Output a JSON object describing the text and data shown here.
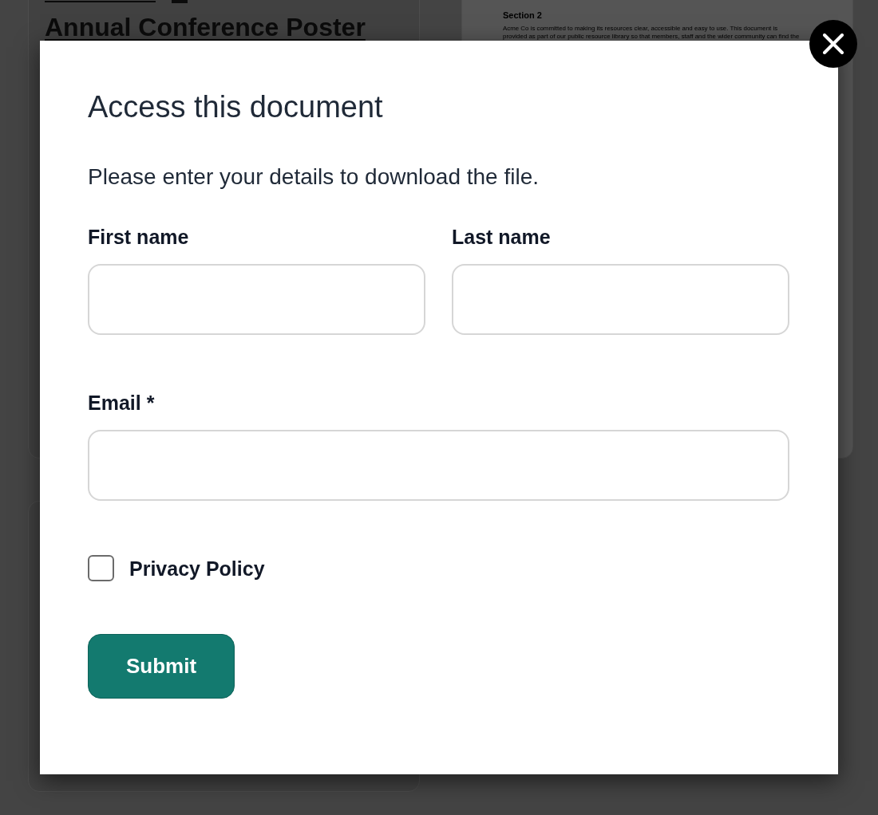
{
  "background": {
    "cards": [
      {
        "kind": "link",
        "title": "Annual Conference Poster"
      },
      {
        "kind": "document",
        "heading": "Section 2",
        "text": "Acme Co is committed to making its resources clear, accessible and easy to use. This document is\nprovided as part of our public resource library so that members, staff and the wider community can find the"
      },
      {
        "kind": "empty"
      }
    ]
  },
  "modal": {
    "title": "Access this document",
    "intro": "Please enter your details to download the file.",
    "field_rows": [
      [
        {
          "label": "First name"
        },
        {
          "label": "Last name"
        }
      ],
      [
        {
          "label": "Email *"
        }
      ]
    ],
    "checkbox": {
      "label": "Privacy Policy",
      "checked": false
    },
    "submit": "Submit"
  }
}
